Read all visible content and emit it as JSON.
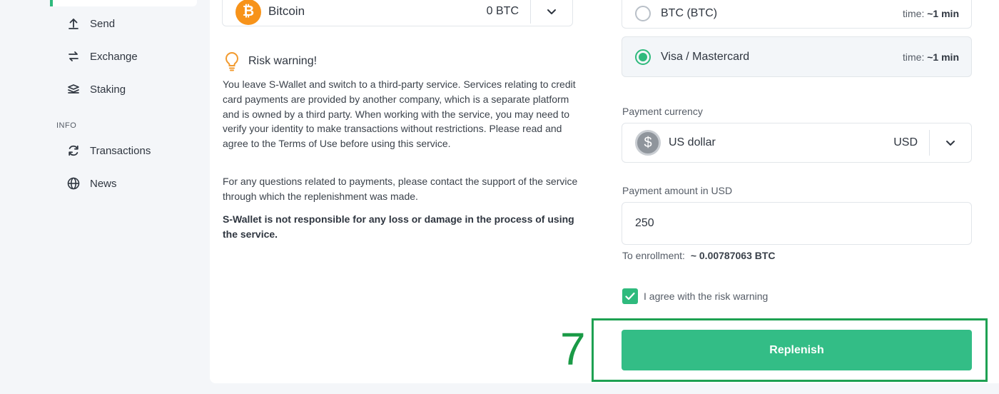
{
  "sidebar": {
    "items": [
      {
        "label": "Send",
        "icon": "upload-icon"
      },
      {
        "label": "Exchange",
        "icon": "exchange-arrows-icon"
      },
      {
        "label": "Staking",
        "icon": "staking-stack-icon"
      }
    ],
    "info_section_label": "INFO",
    "info_items": [
      {
        "label": "Transactions",
        "icon": "refresh-icon"
      },
      {
        "label": "News",
        "icon": "globe-icon"
      }
    ]
  },
  "coin_select": {
    "name": "Bitcoin",
    "balance": "0 BTC",
    "logo_symbol": "₿"
  },
  "risk_warning": {
    "title": "Risk warning!",
    "paragraph1": "You leave S-Wallet and switch to a third-party service. Services relating to credit card payments are provided by another company, which is a separate platform and is owned by a third party. When working with the service, you may need to verify your identity to make transactions without restrictions. Please read and agree to the Terms of Use before using this service.",
    "paragraph2": "For any questions related to payments, please contact the support of the service through which the replenishment was made.",
    "paragraph3": "S-Wallet is not responsible for any loss or damage in the process of using the service."
  },
  "payment_methods": [
    {
      "name": "BTC (BTC)",
      "time_label": "time:",
      "time_value": "~1 min",
      "selected": false
    },
    {
      "name": "Visa / Mastercard",
      "time_label": "time:",
      "time_value": "~1 min",
      "selected": true
    }
  ],
  "payment_currency": {
    "label": "Payment currency",
    "name": "US dollar",
    "code": "USD",
    "logo_symbol": "$"
  },
  "payment_amount": {
    "label": "Payment amount in USD",
    "value": "250"
  },
  "enrollment": {
    "label": "To enrollment:",
    "value": "~ 0.00787063 BTC"
  },
  "agree": {
    "label": "I agree with the risk warning",
    "checked": true
  },
  "replenish_label": "Replenish",
  "annotation_step": "7",
  "colors": {
    "accent": "#33bd86",
    "bitcoin": "#f7931a",
    "annotation": "#1a9a46"
  }
}
